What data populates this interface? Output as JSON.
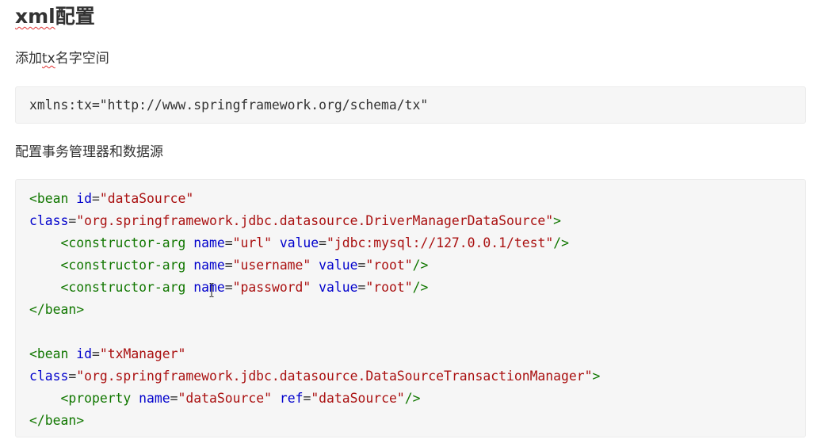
{
  "heading": {
    "spell_part": "xml",
    "rest": "配置"
  },
  "para1": {
    "before": "添加",
    "spell_part": "tx",
    "after": "名字空间"
  },
  "namespace_code": "xmlns:tx=\"http://www.springframework.org/schema/tx\"",
  "para2": "配置事务管理器和数据源",
  "code": {
    "bean1_open": "<bean",
    "bean1_id_attr": "id",
    "bean1_id_val": "\"dataSource\"",
    "bean1_class_attr": "class",
    "bean1_class_val": "\"org.springframework.jdbc.datasource.DriverManagerDataSource\"",
    "gt": ">",
    "ctor_tag": "<constructor-arg",
    "name_attr": "name",
    "value_attr": "value",
    "url_name": "\"url\"",
    "url_value": "\"jdbc:mysql://127.0.0.1/test\"",
    "user_name": "\"username\"",
    "user_value": "\"root\"",
    "pass_name": "\"password\"",
    "pass_value": "\"root\"",
    "self_close": "/>",
    "bean_close": "</bean>",
    "bean2_open": "<bean",
    "bean2_id_val": "\"txManager\"",
    "bean2_class_val": "\"org.springframework.jdbc.datasource.DataSourceTransactionManager\"",
    "property_tag": "<property",
    "prop_name_val": "\"dataSource\"",
    "ref_attr": "ref",
    "prop_ref_val": "\"dataSource\""
  },
  "colors": {
    "tag": "#117700",
    "attr": "#0000cc",
    "string": "#aa1111",
    "code_background": "#f6f6f6"
  },
  "icons": [
    "text-cursor-icon"
  ]
}
